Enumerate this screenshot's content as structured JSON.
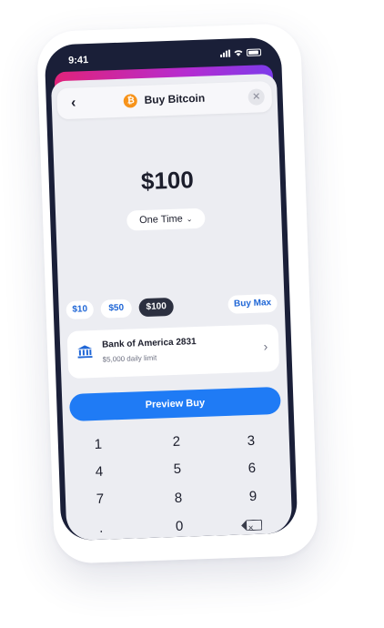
{
  "status_bar": {
    "time": "9:41"
  },
  "header": {
    "back_icon": "chevron-left-icon",
    "title": "Buy Bitcoin",
    "coin_icon": "bitcoin-icon",
    "coin_glyph": "₿",
    "close_icon": "close-icon"
  },
  "amount": {
    "value": "$100"
  },
  "frequency": {
    "selected": "One Time"
  },
  "quick_amounts": {
    "options": [
      "$10",
      "$50",
      "$100"
    ],
    "selected": "$100",
    "buy_max_label": "Buy Max"
  },
  "payment": {
    "icon": "bank-icon",
    "name": "Bank of America 2831",
    "limit": "$5,000 daily limit"
  },
  "actions": {
    "preview_label": "Preview Buy"
  },
  "keypad": {
    "rows": [
      [
        "1",
        "2",
        "3"
      ],
      [
        "4",
        "5",
        "6"
      ],
      [
        "7",
        "8",
        "9"
      ],
      [
        ".",
        "0",
        ""
      ]
    ],
    "backspace_icon": "backspace-icon"
  },
  "colors": {
    "accent_blue": "#1f7bf5",
    "bitcoin_orange": "#f7931a",
    "selected_chip": "#2c3040",
    "screen_background": "#ecedf2"
  }
}
